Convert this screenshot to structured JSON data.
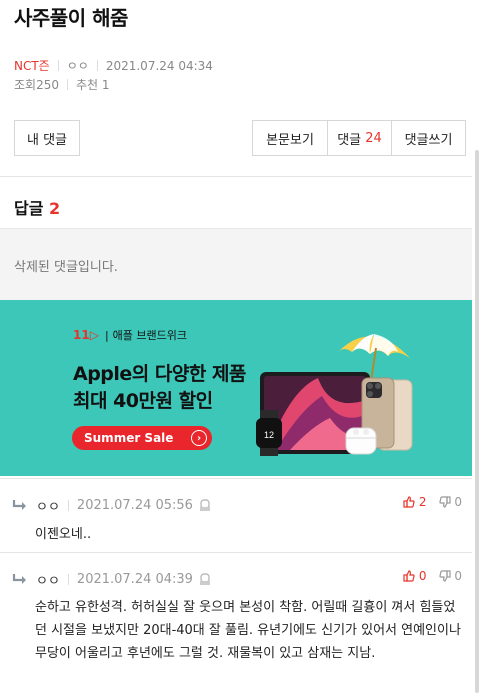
{
  "post": {
    "title": "사주풀이 해줌",
    "author": "NCT즌",
    "nickname": "ㅇㅇ",
    "datetime": "2021.07.24 04:34",
    "views_label": "조회",
    "views": "250",
    "recommend_label": "추천",
    "recommend": "1"
  },
  "toolbar": {
    "my_comments": "내 댓글",
    "view_post": "본문보기",
    "comments_label": "댓글",
    "comments_count": "24",
    "write_comment": "댓글쓰기"
  },
  "replies": {
    "label": "답글",
    "count": "2",
    "deleted_text": "삭제된 댓글입니다."
  },
  "banner": {
    "brand_num": "11",
    "brand_name": "애플 브랜드위크",
    "headline1": "Apple의 다양한 제품",
    "headline2": "최대 40만원 할인",
    "cta": "Summer Sale",
    "watch_date": "12"
  },
  "comments": [
    {
      "nickname": "ㅇㅇ",
      "date": "2021.07.24 05:56",
      "up": "2",
      "down": "0",
      "body": "이젠오네.."
    },
    {
      "nickname": "ㅇㅇ",
      "date": "2021.07.24 04:39",
      "up": "0",
      "down": "0",
      "body": "순하고 유한성격. 허허실실 잘 웃으며 본성이 착함. 어릴때 길흉이 껴서 힘들었던 시절을 보냈지만 20대-40대 잘 풀림. 유년기에도 신기가 있어서 연예인이나 무당이 어울리고 후년에도 그럴 것. 재물복이 있고 삼재는 지남."
    }
  ],
  "colors": {
    "accent": "#e8332a",
    "banner_bg": "#3cc7b9"
  }
}
